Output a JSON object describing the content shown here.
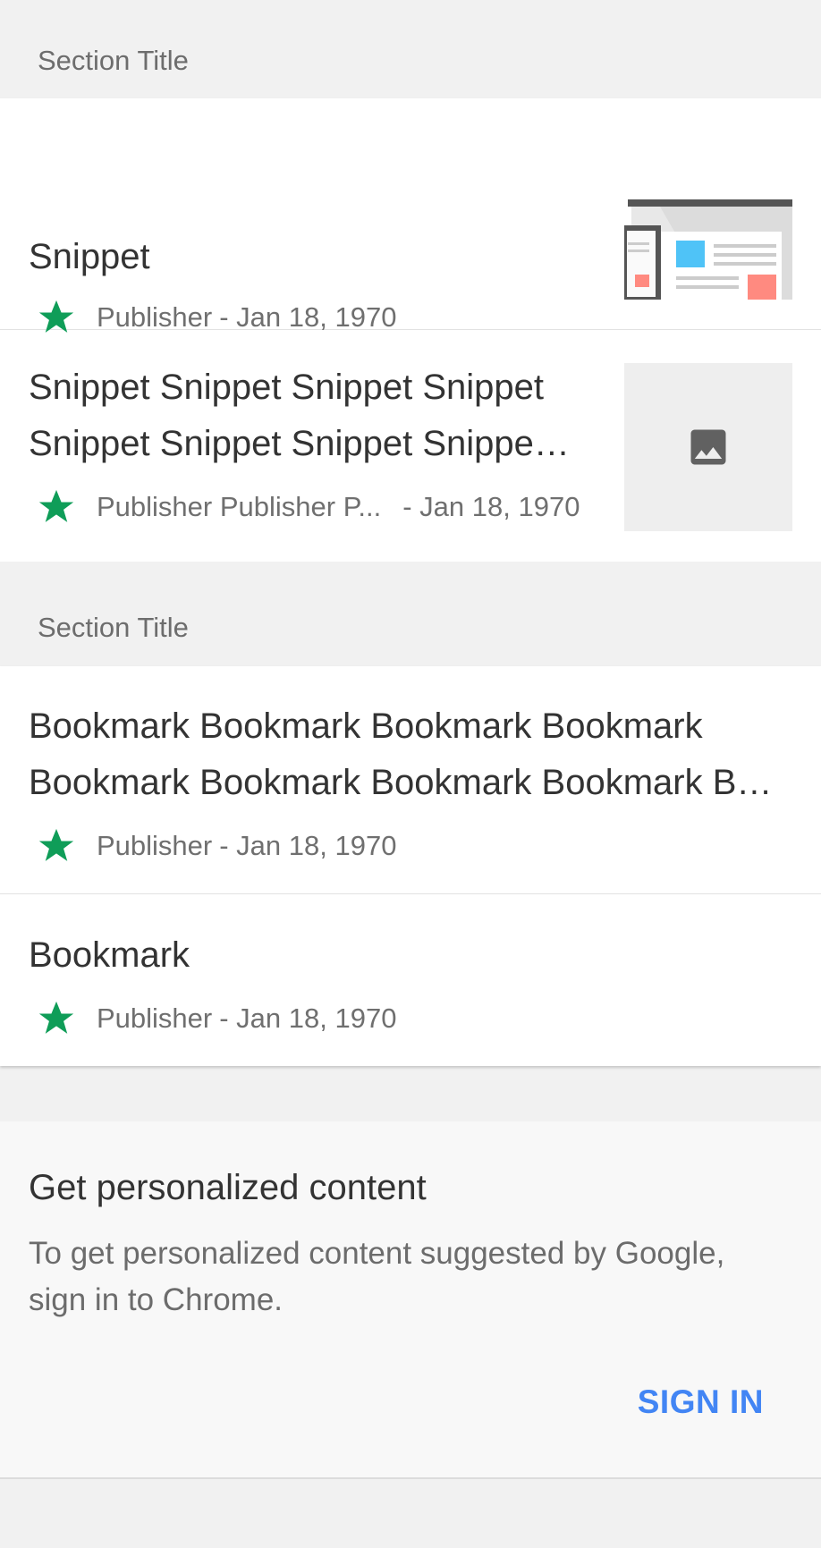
{
  "sections": [
    {
      "title": "Section Title",
      "items": [
        {
          "title": "Snippet",
          "publisher": "Publisher",
          "date": "- Jan 18, 1970"
        },
        {
          "title_line1": "Snippet Snippet Snippet Snippet",
          "title_line2": "Snippet Snippet Snippet Snippe…",
          "publisher": "Publisher Publisher P...",
          "date": "- Jan 18, 1970"
        }
      ]
    },
    {
      "title": "Section Title",
      "items": [
        {
          "title_line1": "Bookmark Bookmark Bookmark Bookmark",
          "title_line2": "Bookmark Bookmark Bookmark Bookmark B…",
          "publisher": "Publisher",
          "date": "- Jan 18, 1970"
        },
        {
          "title": "Bookmark",
          "publisher": "Publisher",
          "date": "- Jan 18, 1970"
        }
      ]
    }
  ],
  "promo": {
    "title": "Get personalized content",
    "text": "To get personalized content suggested by Google, sign in to Chrome.",
    "button": "SIGN IN"
  },
  "colors": {
    "star": "#0f9d58",
    "accent": "#4285f4"
  },
  "icons": {
    "star": "star-icon",
    "image_placeholder": "image-icon"
  }
}
